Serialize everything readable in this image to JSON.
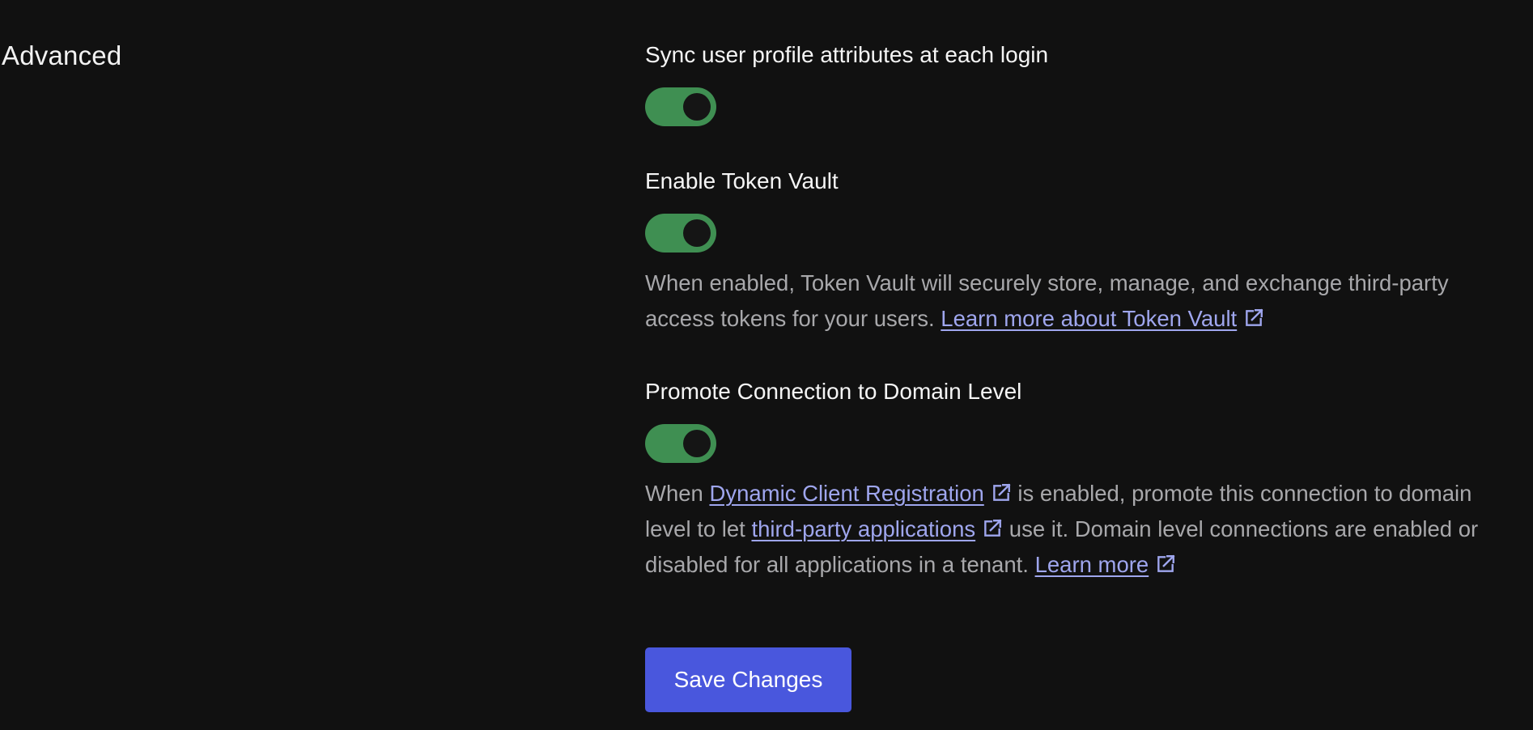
{
  "section": {
    "title": "Advanced"
  },
  "settings": {
    "sync_profile": {
      "label": "Sync user profile attributes at each login",
      "enabled": true
    },
    "token_vault": {
      "label": "Enable Token Vault",
      "enabled": true,
      "description_text": "When enabled, Token Vault will securely store, manage, and exchange third-party access tokens for your users.",
      "link_label": "Learn more about Token Vault"
    },
    "domain_level": {
      "label": "Promote Connection to Domain Level",
      "enabled": true,
      "desc_part1": "When",
      "link1_label": "Dynamic Client Registration",
      "desc_part2": "is enabled, promote this connection to domain level to let",
      "link2_label": "third-party applications",
      "desc_part3": "use it. Domain level connections are enabled or disabled for all applications in a tenant.",
      "link3_label": "Learn more"
    }
  },
  "actions": {
    "save_label": "Save Changes"
  },
  "colors": {
    "background": "#111111",
    "toggle_on": "#3f8f52",
    "link": "#9fa6ee",
    "primary_button": "#4957dd"
  },
  "icons": {
    "external_link": "external-link-icon"
  }
}
